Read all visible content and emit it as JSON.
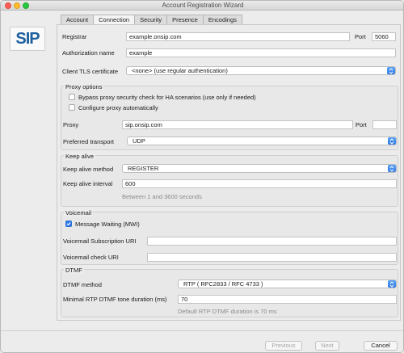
{
  "window": {
    "title": "Account Registration Wizard"
  },
  "logo": {
    "text": "SIP"
  },
  "tabs": [
    {
      "label": "Account",
      "active": false
    },
    {
      "label": "Connection",
      "active": true
    },
    {
      "label": "Security",
      "active": false
    },
    {
      "label": "Presence",
      "active": false
    },
    {
      "label": "Encodings",
      "active": false
    }
  ],
  "form": {
    "registrar_label": "Registrar",
    "registrar_value": "example.onsip.com",
    "port_label": "Port",
    "port_value": "5060",
    "auth_label": "Authorization name",
    "auth_value": "example",
    "tls_label": "Client TLS certificate",
    "tls_value": "<none> (use regular authentication)"
  },
  "proxy": {
    "group_title": "Proxy options",
    "bypass_label": "Bypass proxy security check for HA scenarios (use only if needed)",
    "bypass_checked": false,
    "auto_label": "Configure proxy automatically",
    "auto_checked": false,
    "proxy_label": "Proxy",
    "proxy_value": "sip.onsip.com",
    "port_label": "Port",
    "port_value": "",
    "transport_label": "Preferred transport",
    "transport_value": "UDP"
  },
  "keepalive": {
    "group_title": "Keep alive",
    "method_label": "Keep alive method",
    "method_value": "REGISTER",
    "interval_label": "Keep alive interval",
    "interval_value": "600",
    "interval_hint": "Between 1 and 3600 seconds"
  },
  "voicemail": {
    "group_title": "Voicemail",
    "mwi_label": "Message Waiting (MWI)",
    "mwi_checked": true,
    "sub_uri_label": "Voicemail Subscription URI",
    "sub_uri_value": "",
    "check_uri_label": "Voicemail check URI",
    "check_uri_value": ""
  },
  "dtmf": {
    "group_title": "DTMF",
    "method_label": "DTMF method",
    "method_value": "RTP ( RFC2833 / RFC 4733 )",
    "duration_label": "Minimal RTP DTMF tone duration (ms)",
    "duration_value": "70",
    "duration_hint": "Default RTP DTMF duration is 70 ms"
  },
  "footer": {
    "previous_label": "Previous",
    "next_label": "Next",
    "cancel_label": "Cancel"
  },
  "colors": {
    "accent": "#2f7ae5",
    "logo_blue": "#1d5f9e"
  }
}
